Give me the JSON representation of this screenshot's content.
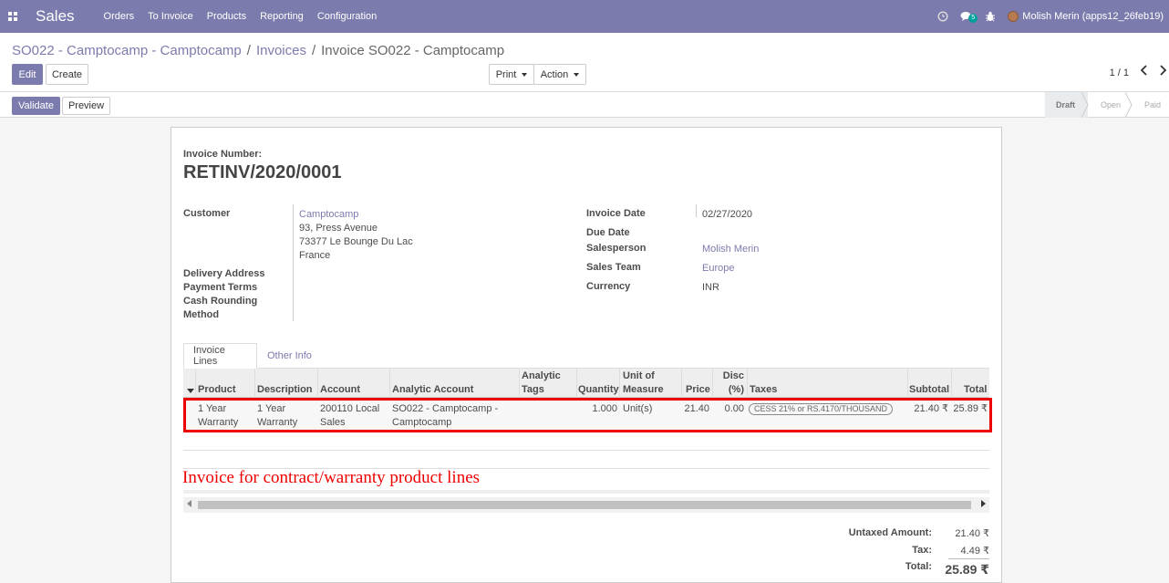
{
  "navbar": {
    "app_name": "Sales",
    "menu": [
      "Orders",
      "To Invoice",
      "Products",
      "Reporting",
      "Configuration"
    ],
    "messages_badge": "5",
    "user_name": "Molish Merin (apps12_26feb19)"
  },
  "breadcrumb": {
    "items": [
      "SO022 - Camptocamp - Camptocamp",
      "Invoices"
    ],
    "current": "Invoice SO022 - Camptocamp"
  },
  "buttons": {
    "edit": "Edit",
    "create": "Create",
    "print": "Print",
    "action": "Action",
    "validate": "Validate",
    "preview": "Preview"
  },
  "pager": {
    "value": "1 / 1"
  },
  "statusbar": {
    "stages": [
      "Draft",
      "Open",
      "Paid"
    ],
    "current": "Draft"
  },
  "invoice": {
    "number_label": "Invoice Number:",
    "number": "RETINV/2020/0001",
    "left": {
      "customer_label": "Customer",
      "customer_name": "Camptocamp",
      "address": [
        "93, Press Avenue",
        "73377 Le Bounge Du Lac",
        "France"
      ],
      "delivery_label": "Delivery Address",
      "payment_terms_label": "Payment Terms",
      "cash_rounding_label": "Cash Rounding",
      "cash_rounding_label2": "Method"
    },
    "right": {
      "invoice_date_label": "Invoice Date",
      "invoice_date": "02/27/2020",
      "due_date_label": "Due Date",
      "salesperson_label": "Salesperson",
      "salesperson": "Molish Merin",
      "sales_team_label": "Sales Team",
      "sales_team": "Europe",
      "currency_label": "Currency",
      "currency": "INR"
    }
  },
  "tabs": [
    "Invoice Lines",
    "Other Info"
  ],
  "lines": {
    "headers": {
      "product": "Product",
      "description": "Description",
      "account": "Account",
      "analytic_account": "Analytic Account",
      "analytic_tags_1": "Analytic",
      "analytic_tags_2": "Tags",
      "quantity": "Quantity",
      "uom_1": "Unit of",
      "uom_2": "Measure",
      "price": "Price",
      "disc_1": "Disc",
      "disc_2": "(%)",
      "taxes": "Taxes",
      "subtotal": "Subtotal",
      "total": "Total"
    },
    "row": {
      "product_1": "1 Year",
      "product_2": "Warranty",
      "description_1": "1 Year",
      "description_2": "Warranty",
      "account_1": "200110 Local",
      "account_2": "Sales",
      "analytic_1": "SO022 - Camptocamp -",
      "analytic_2": "Camptocamp",
      "quantity": "1.000",
      "uom": "Unit(s)",
      "price": "21.40",
      "discount": "0.00",
      "tax": "CESS 21% or RS.4170/THOUSAND",
      "subtotal": "21.40 ₹",
      "total": "25.89 ₹"
    }
  },
  "annotation": "Invoice for contract/warranty product lines",
  "totals": {
    "untaxed_label": "Untaxed Amount:",
    "untaxed": "21.40 ₹",
    "tax_label": "Tax:",
    "tax": "4.49 ₹",
    "total_label": "Total:",
    "total": "25.89 ₹"
  },
  "colors": {
    "brand": "#7c7bad",
    "highlight": "#e00000"
  }
}
